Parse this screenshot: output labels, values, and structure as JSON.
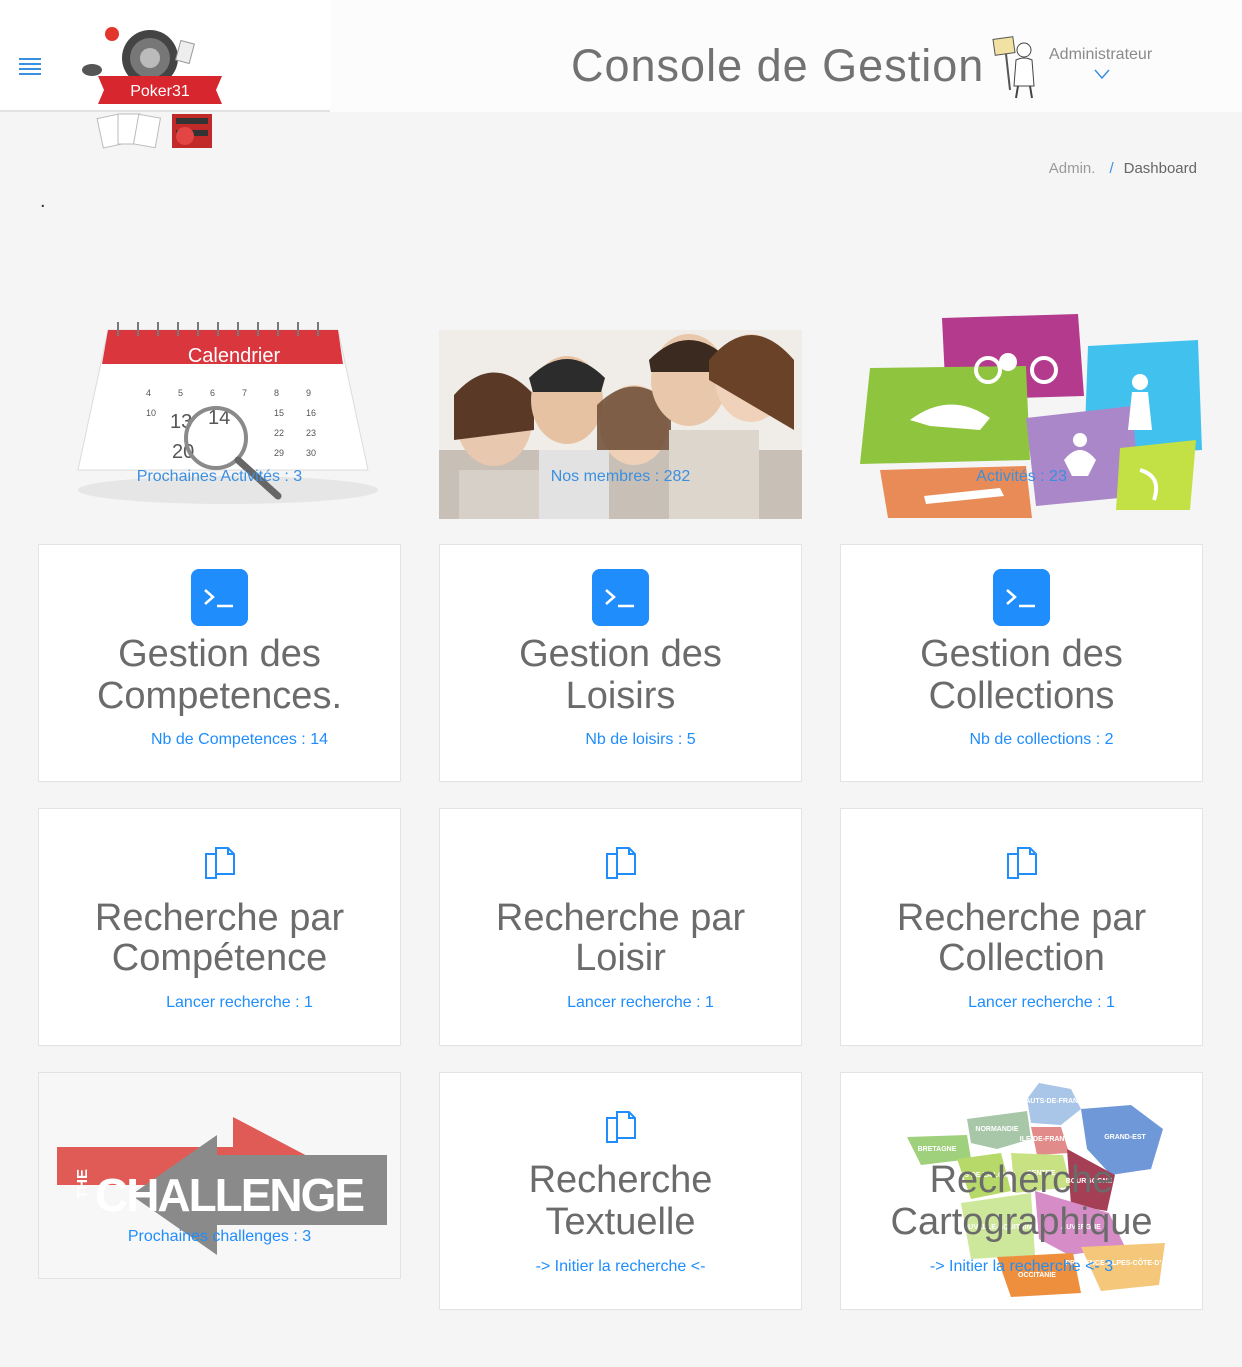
{
  "header": {
    "title": "Console de Gestion",
    "user_name": "Administrateur",
    "logo_text": "Poker31"
  },
  "breadcrumb": {
    "root": "Admin.",
    "separator": "/",
    "current": "Dashboard"
  },
  "marker": ".",
  "tiles": [
    {
      "caption": "Prochaines Activités : 3",
      "image_text": "Calendrier",
      "image_numbers": [
        "13",
        "14",
        "20"
      ]
    },
    {
      "caption": "Nos membres : 282"
    },
    {
      "caption": "Activités : 23"
    }
  ],
  "management_cards": [
    {
      "title_line1": "Gestion des",
      "title_line2": "Competences.",
      "link": "Nb de Competences : 14"
    },
    {
      "title_line1": "Gestion des",
      "title_line2": "Loisirs",
      "link": "Nb de loisirs : 5"
    },
    {
      "title_line1": "Gestion des",
      "title_line2": "Collections",
      "link": "Nb de collections : 2"
    }
  ],
  "search_cards": [
    {
      "title_line1": "Recherche par",
      "title_line2": "Compétence",
      "link": "Lancer recherche : 1"
    },
    {
      "title_line1": "Recherche par",
      "title_line2": "Loisir",
      "link": "Lancer recherche : 1"
    },
    {
      "title_line1": "Recherche par",
      "title_line2": "Collection",
      "link": "Lancer recherche : 1"
    }
  ],
  "challenge": {
    "logo_the": "THE",
    "logo_word": "CHALLENGE",
    "caption": "Prochaines challenges : 3"
  },
  "text_search": {
    "title_line1": "Recherche",
    "title_line2": "Textuelle",
    "link": "-> Initier la recherche <-"
  },
  "map_search": {
    "title_line1": "Recherche",
    "title_line2": "Cartographique",
    "link": "-> Initier la recherche <- 3",
    "regions": [
      "HAUTS-DE-FRANCE",
      "NORMANDIE",
      "BRETAGNE",
      "ILE-DE-FRANCE",
      "GRAND-EST",
      "PAYS DE LA LOIRE",
      "CENTRE",
      "BOURGOGNE",
      "NOUVELLE-AQUITAINE",
      "AUVERGNE",
      "OCCITANIE",
      "PROVENCE-ALPES-CÔTE-D'AZUR"
    ]
  },
  "colors": {
    "accent": "#1f8dfb",
    "text": "#6b6b6b",
    "background": "#f5f5f5"
  }
}
